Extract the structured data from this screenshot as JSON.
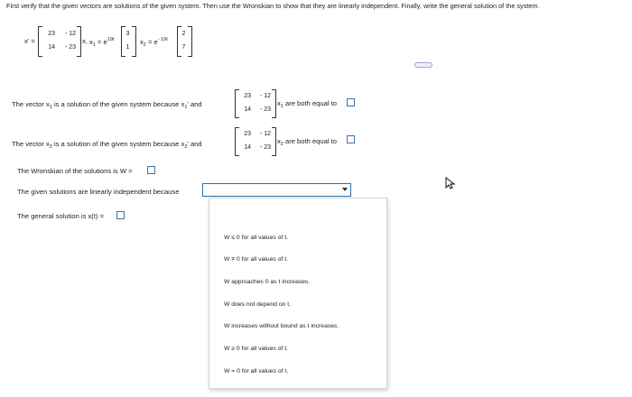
{
  "intro": "First verify that the given vectors are solutions of the given system. Then use the Wronskian to show that they are linearly independent. Finally, write the general solution of the system.",
  "system": {
    "xprime": "x' =",
    "A": [
      "23",
      "- 12",
      "14",
      "- 23"
    ],
    "x_label": "x,",
    "x1_label": "x",
    "x1_sub": "1",
    "x1_eq": "= e",
    "x1_exp": "19t",
    "x1_vec": [
      "3",
      "1"
    ],
    "x2_label": "x",
    "x2_sub": "2",
    "x2_eq": "= e",
    "x2_exp": "- 19t",
    "x2_vec": [
      "2",
      "7"
    ]
  },
  "q1": {
    "pre": "The vector x",
    "sub": "1",
    "mid": " is a solution of the given system because x",
    "sub2": "1",
    "mid2": "' and",
    "matrix": [
      "23",
      "- 12",
      "14",
      "- 23"
    ],
    "post_x": "x",
    "post_sub": "1",
    "post": " are both equal to"
  },
  "q2": {
    "pre": "The vector x",
    "sub": "2",
    "mid": " is a solution of the given system because x",
    "sub2": "2",
    "mid2": "' and",
    "matrix": [
      "23",
      "- 12",
      "14",
      "- 23"
    ],
    "post_x": "x",
    "post_sub": "2",
    "post": " are both equal to"
  },
  "wronskian": "The Wronskian of the solutions is W =",
  "independence": "The given solutions are linearly independent because",
  "general": "The general solution is x(t) =",
  "menu": [
    "W ≤ 0 for all values of t.",
    "W ≠ 0 for all values of t.",
    "W approaches 0 as t increases.",
    "W does not depend on t.",
    "W increases without bound as t increases.",
    "W ≥ 0 for all values of t.",
    "W = 0 for all values of t."
  ],
  "more_button": "·····"
}
